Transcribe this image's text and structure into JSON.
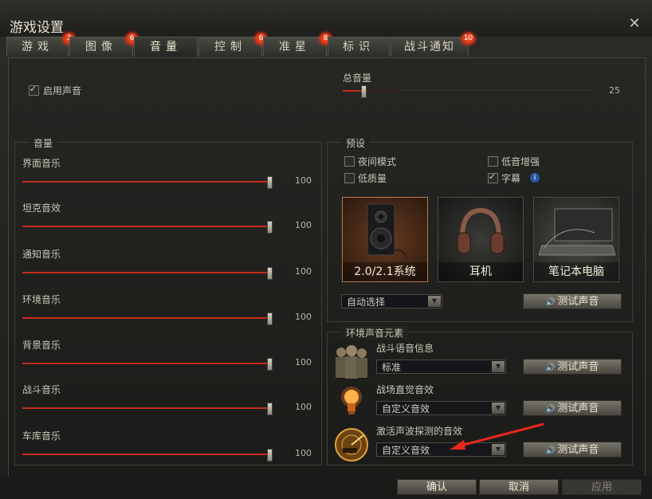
{
  "window": {
    "title": "游戏设置",
    "close_icon": "close-icon"
  },
  "tabs": [
    {
      "label": "游戏",
      "badge": "3"
    },
    {
      "label": "图像",
      "badge": "6"
    },
    {
      "label": "音量",
      "badge": ""
    },
    {
      "label": "控制",
      "badge": "6"
    },
    {
      "label": "准星",
      "badge": "8"
    },
    {
      "label": "标识",
      "badge": ""
    },
    {
      "label": "战斗通知",
      "badge": "10"
    }
  ],
  "active_tab": "音量",
  "enable_sound": {
    "label": "启用声音",
    "checked": true
  },
  "master_volume": {
    "label": "总音量",
    "value": "25",
    "level": 25
  },
  "volume_group": {
    "title": "音量",
    "sliders": [
      {
        "label": "界面音乐",
        "value": "100",
        "level": 100
      },
      {
        "label": "坦克音效",
        "value": "100",
        "level": 100
      },
      {
        "label": "通知音乐",
        "value": "100",
        "level": 100
      },
      {
        "label": "环境音乐",
        "value": "100",
        "level": 100
      },
      {
        "label": "背景音乐",
        "value": "100",
        "level": 100
      },
      {
        "label": "战斗音乐",
        "value": "100",
        "level": 100
      },
      {
        "label": "车库音乐",
        "value": "100",
        "level": 100
      }
    ]
  },
  "preset_group": {
    "title": "预设",
    "options": [
      {
        "label": "夜间模式",
        "checked": false
      },
      {
        "label": "低质量",
        "checked": false
      },
      {
        "label": "低音增强",
        "checked": false
      },
      {
        "label": "字幕",
        "checked": true
      }
    ],
    "info_icon": "info-icon",
    "devices": [
      {
        "label": "2.0/2.1系统",
        "icon": "speaker-icon",
        "selected": true
      },
      {
        "label": "耳机",
        "icon": "headphones-icon",
        "selected": false
      },
      {
        "label": "笔记本电脑",
        "icon": "laptop-icon",
        "selected": false
      }
    ],
    "device_select": "自动选择",
    "test_button": "测试声音"
  },
  "ambient_group": {
    "title": "环境声音元素",
    "items": [
      {
        "label": "战斗语音信息",
        "icon": "crew-icon",
        "select": "标准",
        "test_button": "测试声音"
      },
      {
        "label": "战场直觉音效",
        "icon": "lightbulb-icon",
        "select": "自定义音效",
        "test_button": "测试声音"
      },
      {
        "label": "激活声波探测的音效",
        "icon": "radar-icon",
        "select": "自定义音效",
        "test_button": "测试声音"
      }
    ]
  },
  "footer": {
    "ok": "确认",
    "cancel": "取消",
    "apply": "应用"
  },
  "colors": {
    "accent_red": "#c42d1c",
    "badge": "#e03a16",
    "annotation_arrow": "#e8261c"
  }
}
